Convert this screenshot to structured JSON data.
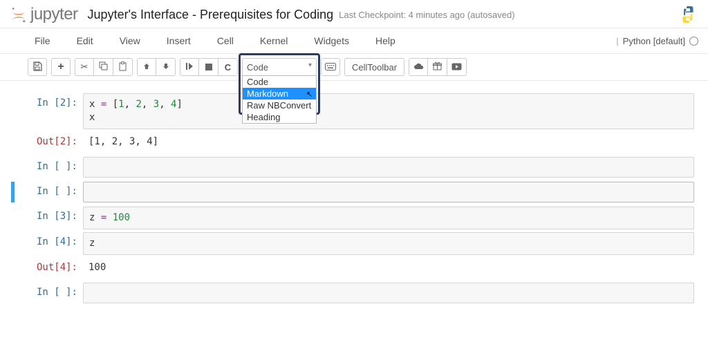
{
  "header": {
    "logo_text": "jupyter",
    "title": "Jupyter's Interface - Prerequisites for Coding",
    "checkpoint": "Last Checkpoint: 4 minutes ago (autosaved)"
  },
  "kernel": {
    "label": "Python [default]"
  },
  "menu": {
    "file": "File",
    "edit": "Edit",
    "view": "View",
    "insert": "Insert",
    "cell": "Cell",
    "kernel": "Kernel",
    "widgets": "Widgets",
    "help": "Help"
  },
  "toolbar": {
    "save": "💾",
    "add": "+",
    "cut": "✂",
    "copy": "⧉",
    "paste": "📋",
    "up": "↑",
    "down": "↓",
    "run": "▶",
    "stop": "■",
    "restart": "C",
    "cell_type_selected": "Code",
    "options": {
      "code": "Code",
      "markdown": "Markdown",
      "raw": "Raw NBConvert",
      "heading": "Heading"
    },
    "keyboard": "⌨",
    "celltoolbar": "CellToolbar",
    "cloud": "☁",
    "present": "🎁",
    "play": "▶"
  },
  "cells": {
    "c0_prompt": "In [2]:",
    "c0_code": "x = [1, 2, 3, 4]\nx",
    "c0_out_prompt": "Out[2]:",
    "c0_out": "[1, 2, 3, 4]",
    "empty_prompt": "In [ ]:",
    "c3_prompt": "In [3]:",
    "c3_code": "z = 100",
    "c4_prompt": "In [4]:",
    "c4_code": "z",
    "c4_out_prompt": "Out[4]:",
    "c4_out": "100"
  }
}
